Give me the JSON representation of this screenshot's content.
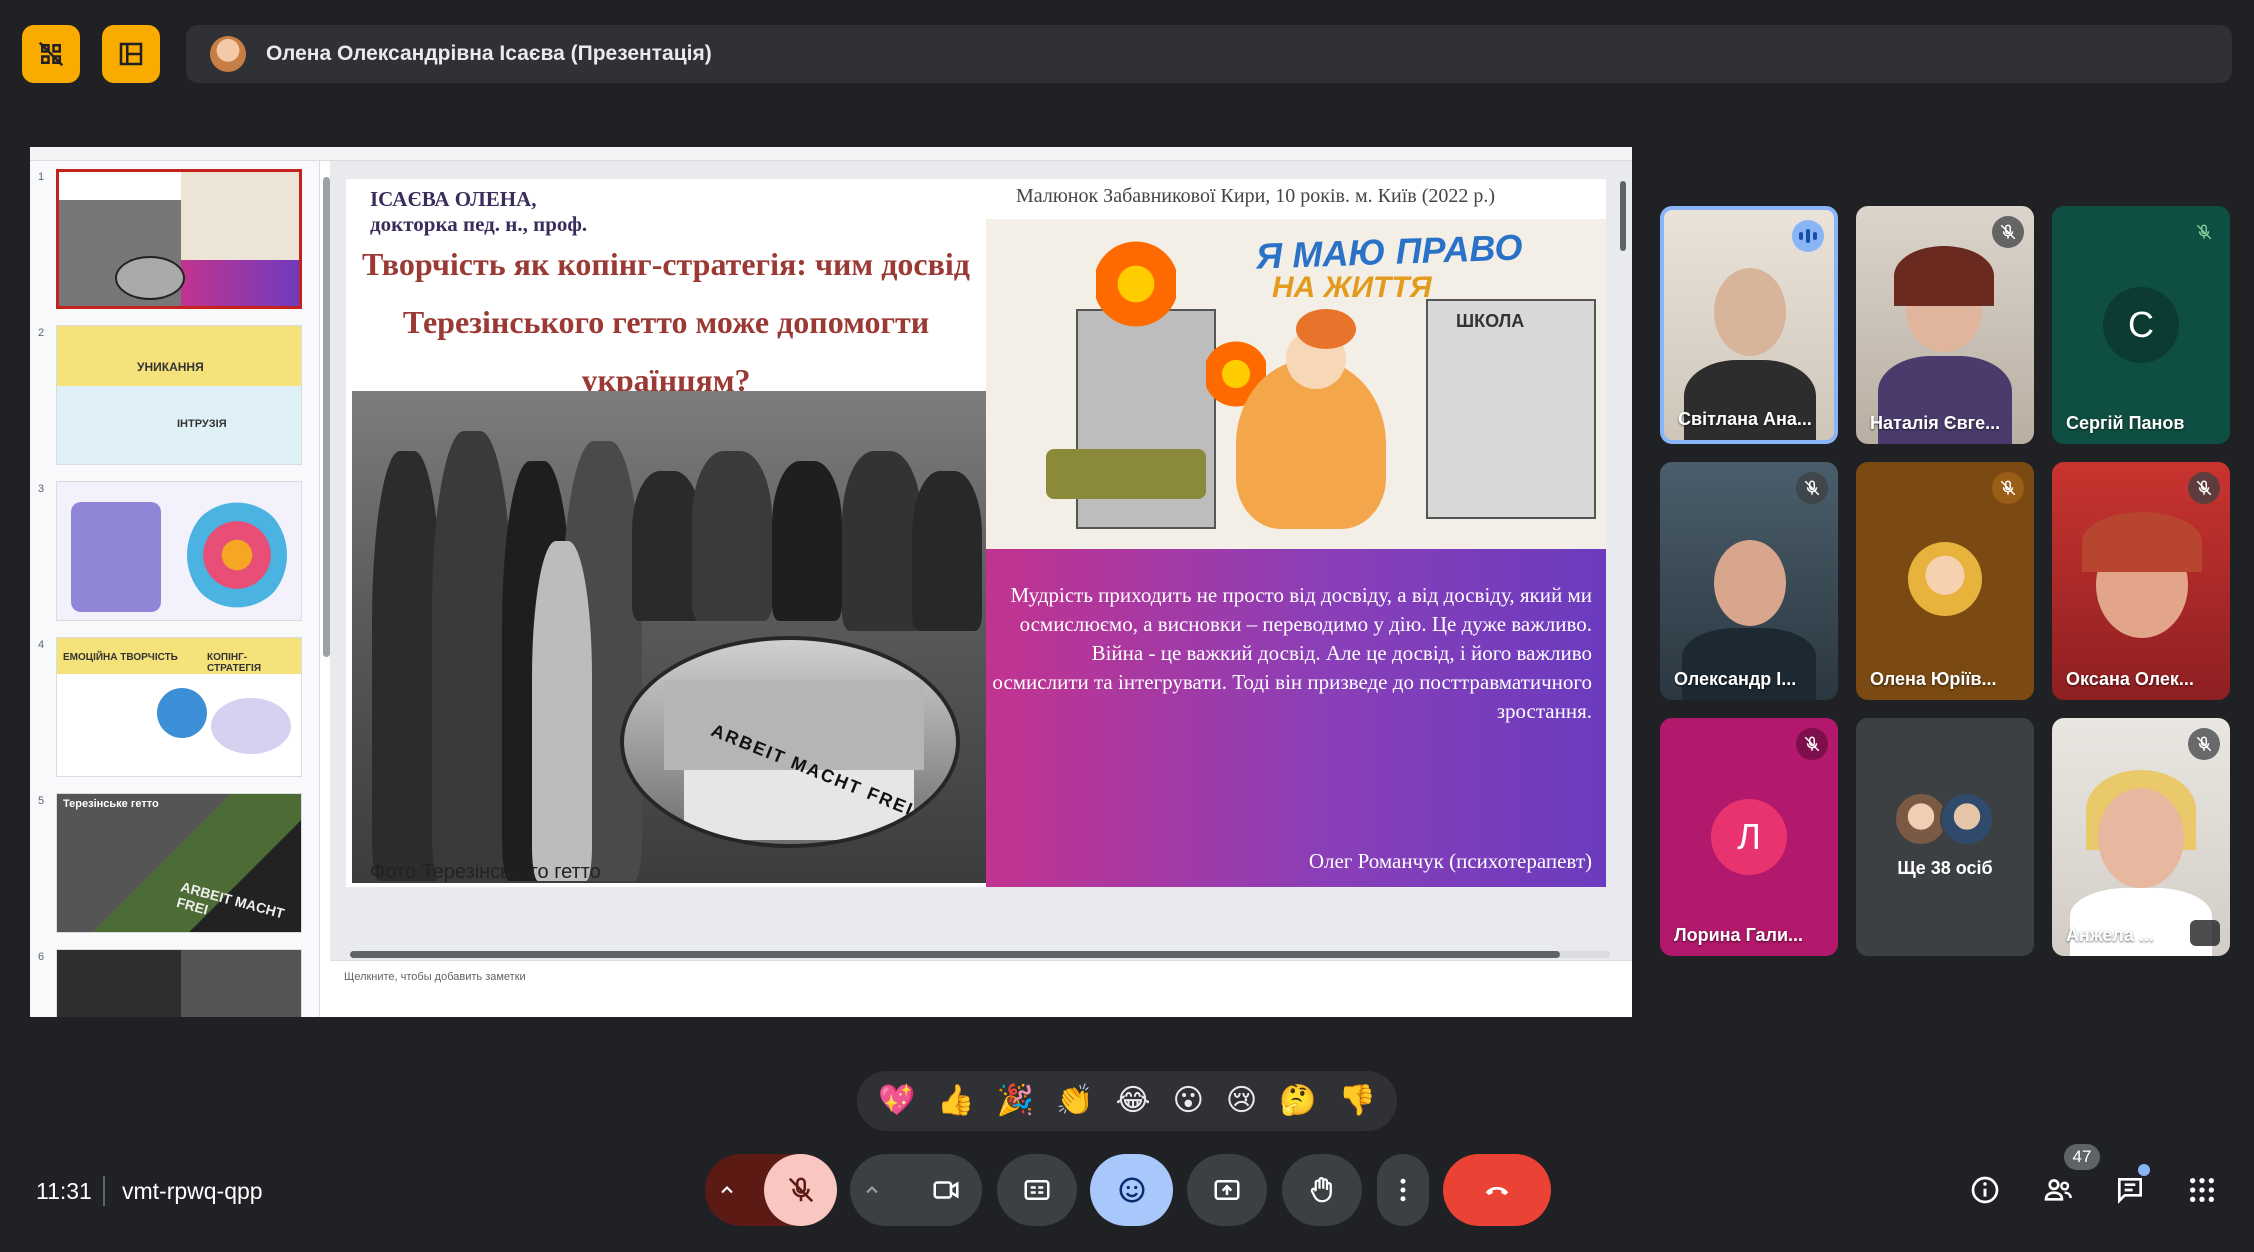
{
  "presenter": {
    "name": "Олена Олександрівна Ісаєва (Презентація)"
  },
  "slide": {
    "author_line1": "ІСАЄВА ОЛЕНА,",
    "author_line2": "докторка пед. н., проф.",
    "title": "Творчість як копінг-стратегія: чим досвід Терезінського гетто може допомогти українцям?",
    "drawing_caption": "Малюнок Забавникової Кири, 10 років. м. Київ (2022 р.)",
    "drawing_text_1": "Я МАЮ ПРАВО",
    "drawing_text_2": "НА ЖИТТЯ",
    "drawing_text_3": "ШКОЛА",
    "photo_sign": "ARBEIT MACHT FREI",
    "photo_caption": "Фото Терезінського гетто",
    "quote": "Мудрість приходить не просто від досвіду, а від досвіду, який ми осмислюємо, а висновки – переводимо у дію. Це дуже важливо. Війна - це важкий досвід. Але це досвід, і його важливо осмислити та інтегрувати. Тоді він призведе до посттравматичного зростання.",
    "quote_author": "Олег Романчук (психотерапевт)"
  },
  "thumbnails": [
    {
      "num": "1",
      "active": true
    },
    {
      "num": "2",
      "active": false
    },
    {
      "num": "3",
      "active": false
    },
    {
      "num": "4",
      "active": false
    },
    {
      "num": "5",
      "active": false
    },
    {
      "num": "6",
      "active": false
    }
  ],
  "thumb_text": {
    "t2": "УНИКАННЯ",
    "t2b": "ІНТРУЗІЯ",
    "t4a": "ЕМОЦІЙНА ТВОРЧІСТЬ",
    "t4b": "КОПІНГ-СТРАТЕГІЯ",
    "t5": "Терезінське гетто",
    "t5b": "ARBEIT MACHT FREI"
  },
  "notes_placeholder": "Щелкните, чтобы добавить заметки",
  "participants": [
    {
      "name": "Світлана Ана...",
      "state": "speaking"
    },
    {
      "name": "Наталія Євге...",
      "state": "muted"
    },
    {
      "name": "Сергій Панов",
      "state": "muted",
      "initial": "С"
    },
    {
      "name": "Олександр І...",
      "state": "muted"
    },
    {
      "name": "Олена Юріїв...",
      "state": "muted"
    },
    {
      "name": "Оксана Олек...",
      "state": "muted"
    },
    {
      "name": "Лорина Гали...",
      "state": "muted",
      "initial": "Л"
    },
    {
      "name": "Ще 38 осіб",
      "state": "more"
    },
    {
      "name": "Анжела ...",
      "state": "muted"
    }
  ],
  "reactions": [
    "💖",
    "👍",
    "🎉",
    "👏",
    "😂",
    "😮",
    "😢",
    "🤔",
    "👎"
  ],
  "meeting": {
    "time": "11:31",
    "code": "vmt-rpwq-qpp",
    "participant_count": "47"
  },
  "colors": {
    "background": "#202124",
    "accent": "#f9ab00",
    "mic_off": "#f28b82",
    "end_call": "#ea4335",
    "active_blue": "#8ab4f8"
  },
  "icons": {
    "top_left_1": "grid-off-icon",
    "top_left_2": "layout-icon",
    "info": "info-icon",
    "people": "people-icon",
    "chat": "chat-icon",
    "activities": "apps-grid-icon"
  }
}
